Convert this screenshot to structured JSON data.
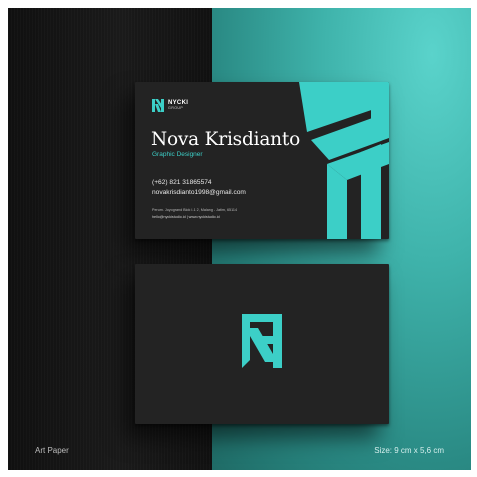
{
  "card_front": {
    "brand_name": "NYCKI",
    "brand_sub": "GROUP",
    "name": "Nova Krisdianto",
    "role": "Graphic Designer",
    "phone": "(+62) 821 31865574",
    "email": "novakrisdianto1998@gmail.com",
    "address": "Perum. Joyogrand Blok I-1 2, Malang - Jatim, 65114",
    "web": "hello@nyckistudio.id | www.nyckistudio.id"
  },
  "captions": {
    "material": "Art Paper",
    "size": "Size: 9 cm x 5,6 cm"
  },
  "colors": {
    "accent": "#3ccfc7",
    "card": "#232323",
    "teal_background": "#3fb3ab",
    "dark_background": "#151515"
  }
}
